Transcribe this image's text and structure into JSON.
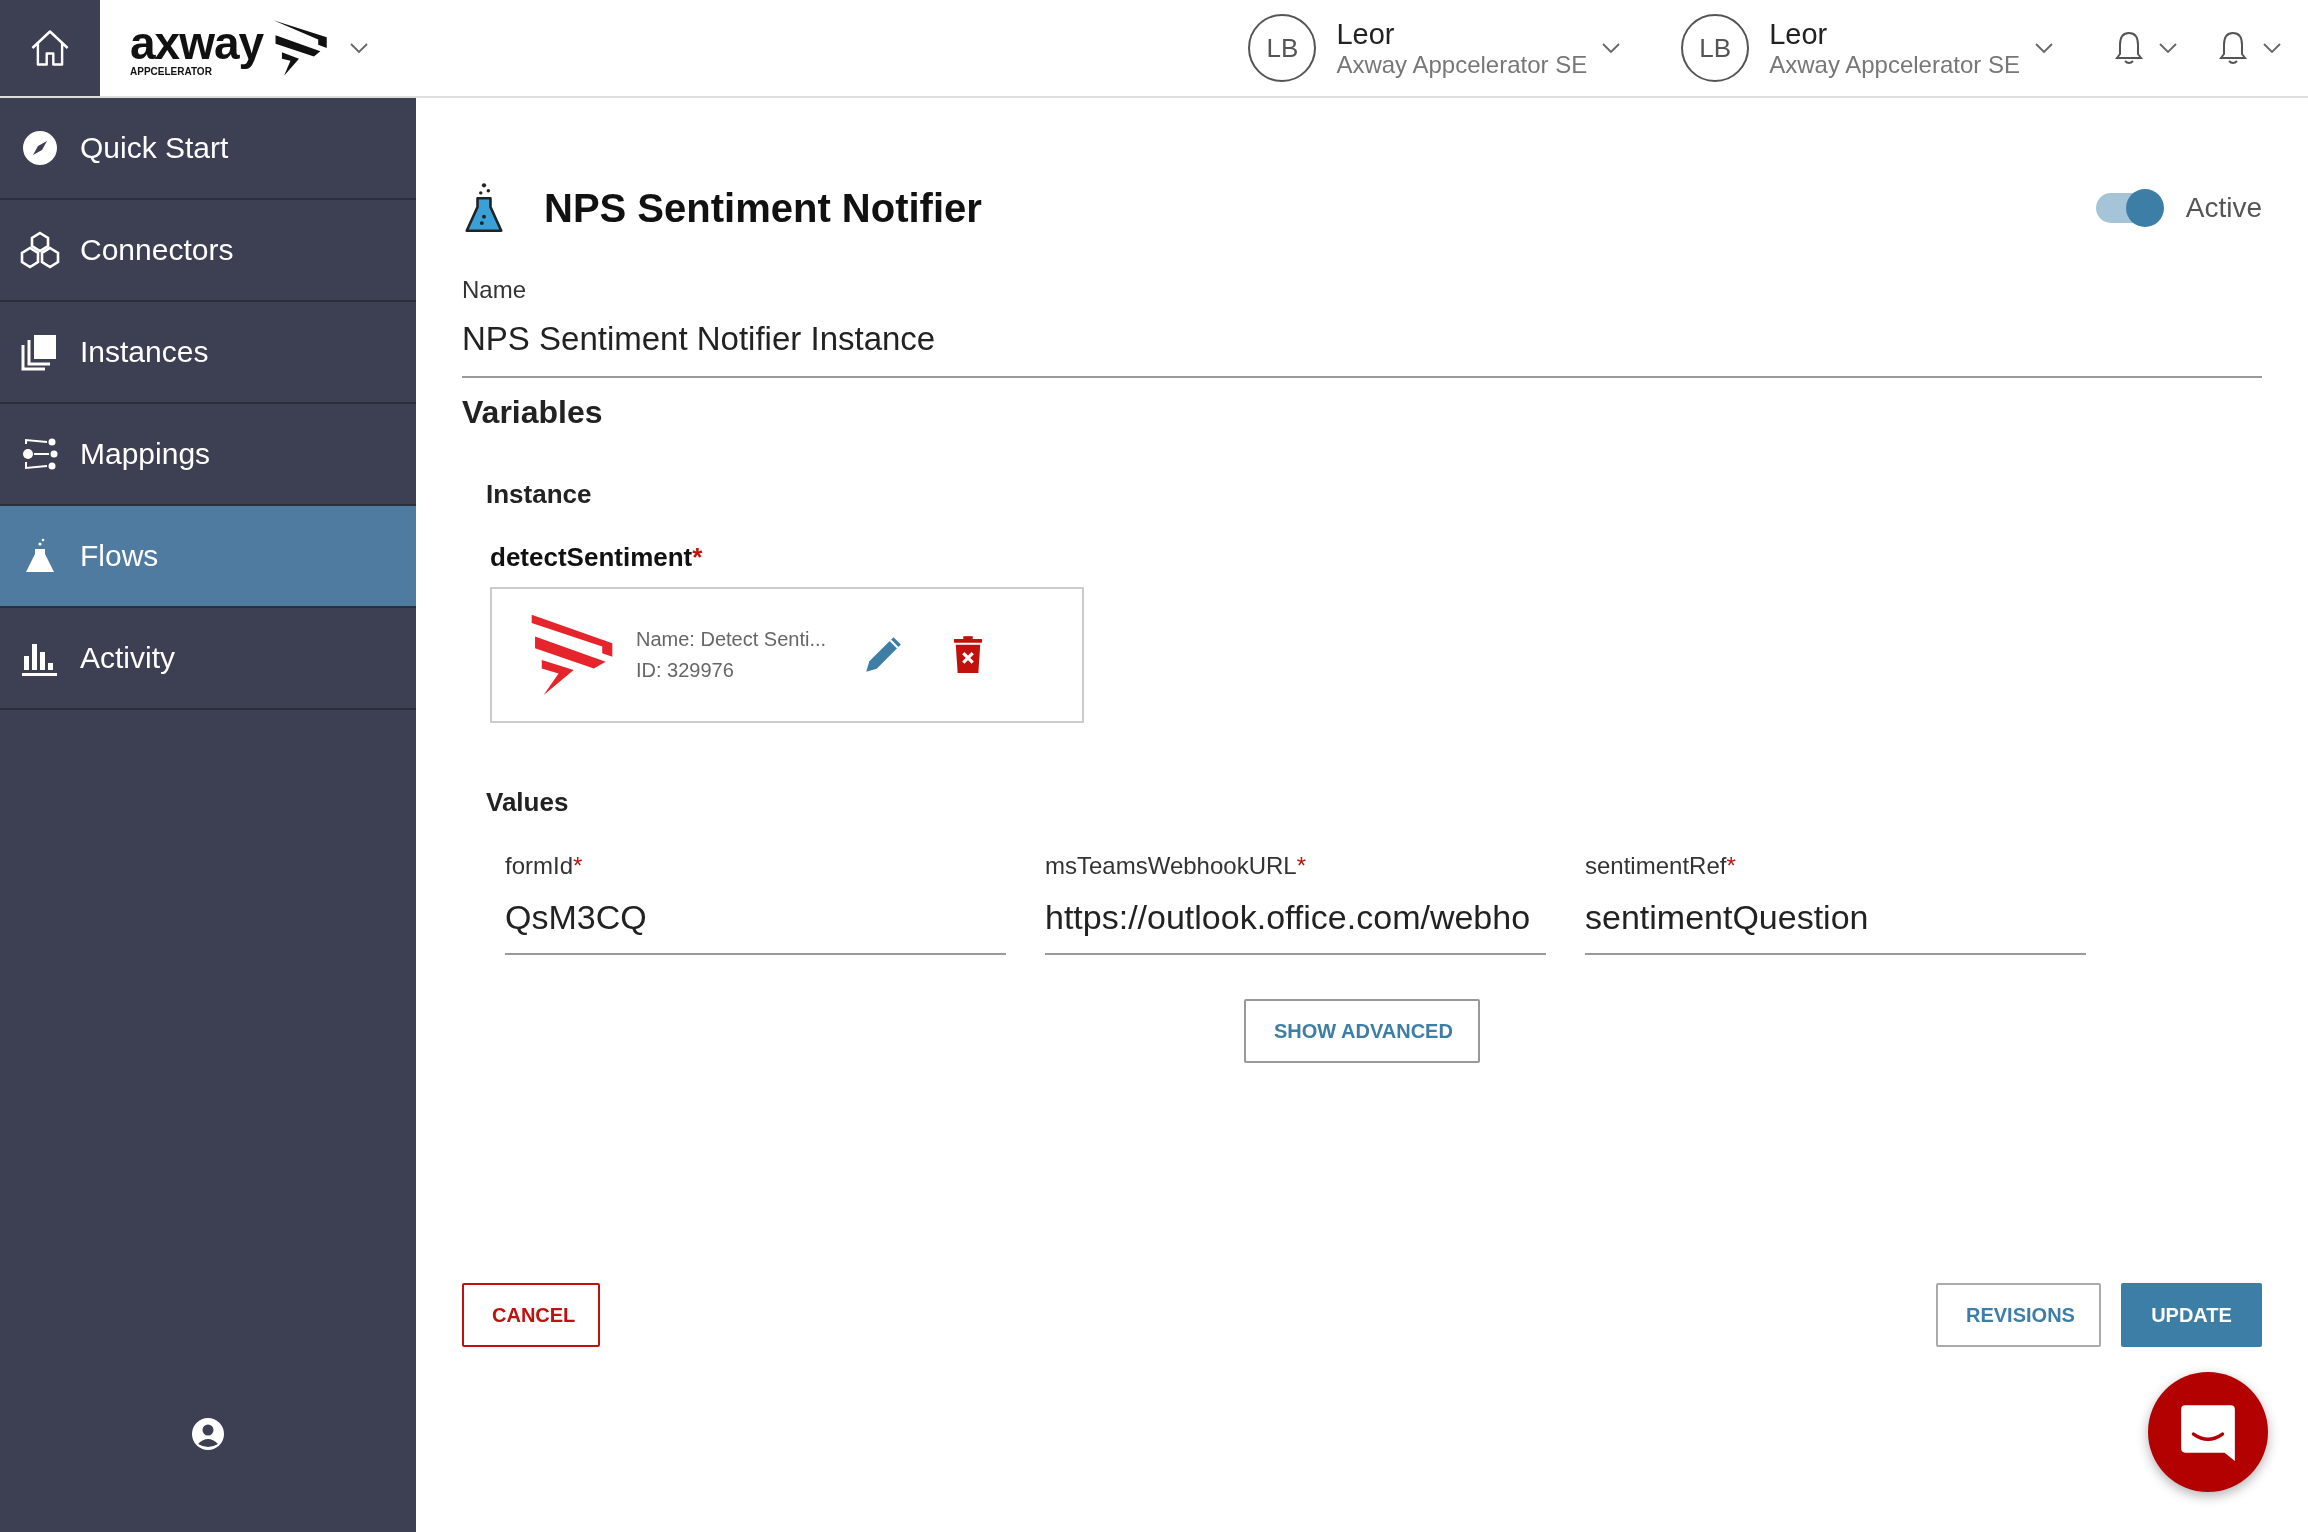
{
  "topbar": {
    "logo": {
      "text": "axway",
      "sub": "APPCELERATOR"
    },
    "accounts": [
      {
        "initials": "LB",
        "name": "Leor",
        "org": "Axway Appcelerator SE"
      },
      {
        "initials": "LB",
        "name": "Leor",
        "org": "Axway Appcelerator SE"
      }
    ]
  },
  "sidebar": {
    "items": [
      {
        "label": "Quick Start",
        "selected": false
      },
      {
        "label": "Connectors",
        "selected": false
      },
      {
        "label": "Instances",
        "selected": false
      },
      {
        "label": "Mappings",
        "selected": false
      },
      {
        "label": "Flows",
        "selected": true
      },
      {
        "label": "Activity",
        "selected": false
      }
    ]
  },
  "form": {
    "title": "NPS Sentiment Notifier",
    "active": {
      "label": "Active",
      "on": true
    },
    "name": {
      "label": "Name",
      "value": "NPS Sentiment Notifier Instance"
    },
    "section": "Variables",
    "required_mark": "*",
    "instance_heading": "Instance",
    "instance_field": {
      "label": "detectSentiment",
      "required": true,
      "card": {
        "name": "Name: Detect Senti...",
        "id": "ID: 329976"
      }
    },
    "values_heading": "Values",
    "values": [
      {
        "label": "formId",
        "required": true,
        "value": "QsM3CQ"
      },
      {
        "label": "msTeamsWebhookURL",
        "required": true,
        "value": "https://outlook.office.com/webho"
      },
      {
        "label": "sentimentRef",
        "required": true,
        "value": "sentimentQuestion"
      }
    ],
    "show_advanced": "SHOW ADVANCED",
    "buttons": {
      "cancel": "CANCEL",
      "revisions": "REVISIONS",
      "update": "UPDATE"
    }
  }
}
